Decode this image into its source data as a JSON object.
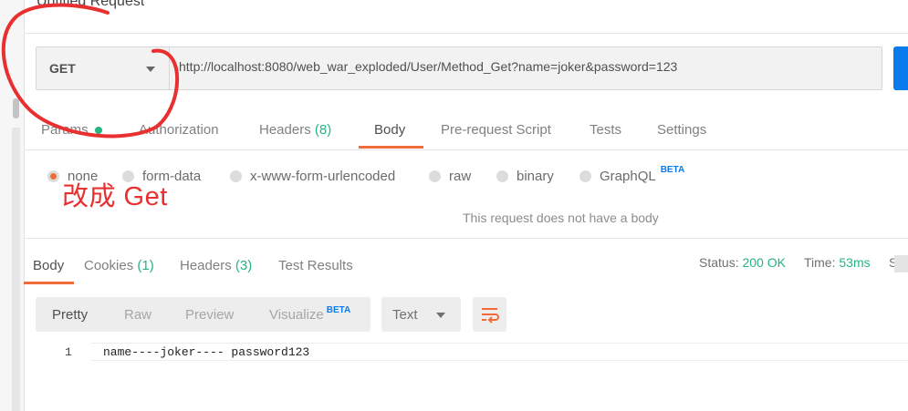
{
  "title": "Untitled Request",
  "request": {
    "method": "GET",
    "url": "http://localhost:8080/web_war_exploded/User/Method_Get?name=joker&password=123"
  },
  "request_tabs": [
    {
      "label": "Params",
      "count": ""
    },
    {
      "label": "Authorization",
      "count": ""
    },
    {
      "label": "Headers",
      "count": "(8)"
    },
    {
      "label": "Body",
      "count": ""
    },
    {
      "label": "Pre-request Script",
      "count": ""
    },
    {
      "label": "Tests",
      "count": ""
    },
    {
      "label": "Settings",
      "count": ""
    }
  ],
  "body_types": [
    {
      "label": "none",
      "selected": true
    },
    {
      "label": "form-data"
    },
    {
      "label": "x-www-form-urlencoded"
    },
    {
      "label": "raw"
    },
    {
      "label": "binary"
    },
    {
      "label": "GraphQL",
      "badge": "BETA"
    }
  ],
  "no_body_note": "This request does not have a body",
  "response_tabs": [
    {
      "label": "Body",
      "count": ""
    },
    {
      "label": "Cookies",
      "count": "(1)"
    },
    {
      "label": "Headers",
      "count": "(3)"
    },
    {
      "label": "Test Results",
      "count": ""
    }
  ],
  "response_meta": {
    "status_label": "Status:",
    "status_value": "200 OK",
    "time_label": "Time:",
    "time_value": "53ms",
    "size_label": "Siz"
  },
  "view_modes": [
    {
      "label": "Pretty"
    },
    {
      "label": "Raw"
    },
    {
      "label": "Preview"
    },
    {
      "label": "Visualize",
      "badge": "BETA"
    }
  ],
  "format_select": "Text",
  "code_lines": [
    {
      "number": "1",
      "text": "name----joker---- password123"
    }
  ],
  "annotation": {
    "text": "改成 Get",
    "color": "#e83030"
  },
  "colors": {
    "accent": "#f26b3a",
    "success": "#26b47f",
    "primary": "#097bed"
  },
  "icons": [
    "dropdown-caret-icon",
    "wrap-lines-icon",
    "radio-icon"
  ]
}
